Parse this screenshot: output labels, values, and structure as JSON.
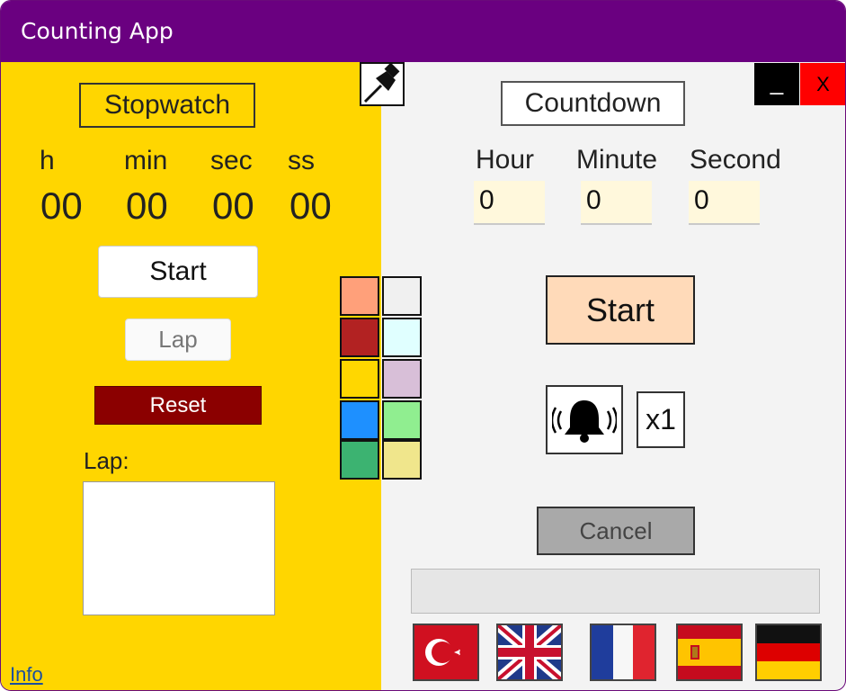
{
  "window": {
    "title": "Counting App"
  },
  "stopwatch": {
    "title": "Stopwatch",
    "units": [
      "h",
      "min",
      "sec",
      "ss"
    ],
    "values": [
      "00",
      "00",
      "00",
      "00"
    ],
    "start_label": "Start",
    "lap_label": "Lap",
    "reset_label": "Reset",
    "laps_title": "Lap:"
  },
  "countdown": {
    "title": "Countdown",
    "hour_label": "Hour",
    "minute_label": "Minute",
    "second_label": "Second",
    "hour_value": "0",
    "minute_value": "0",
    "second_value": "0",
    "start_label": "Start",
    "multiplier_label": "x1",
    "cancel_label": "Cancel"
  },
  "window_controls": {
    "minimize_label": "_",
    "close_label": "X"
  },
  "palette": [
    "#ffa07a",
    "#f0f0f0",
    "#b22222",
    "#e0ffff",
    "#ffd700",
    "#d8bfd8",
    "#1e90ff",
    "#90ee90",
    "#3cb371",
    "#f0e68c"
  ],
  "flags": [
    "turkey-flag",
    "uk-flag",
    "france-flag",
    "spain-flag",
    "germany-flag"
  ],
  "footer": {
    "info_link": "Info"
  },
  "colors": {
    "titlebar": "#6a0080",
    "left_panel": "#ffd600",
    "reset": "#8b0000",
    "countdown_start": "#ffdab9"
  }
}
